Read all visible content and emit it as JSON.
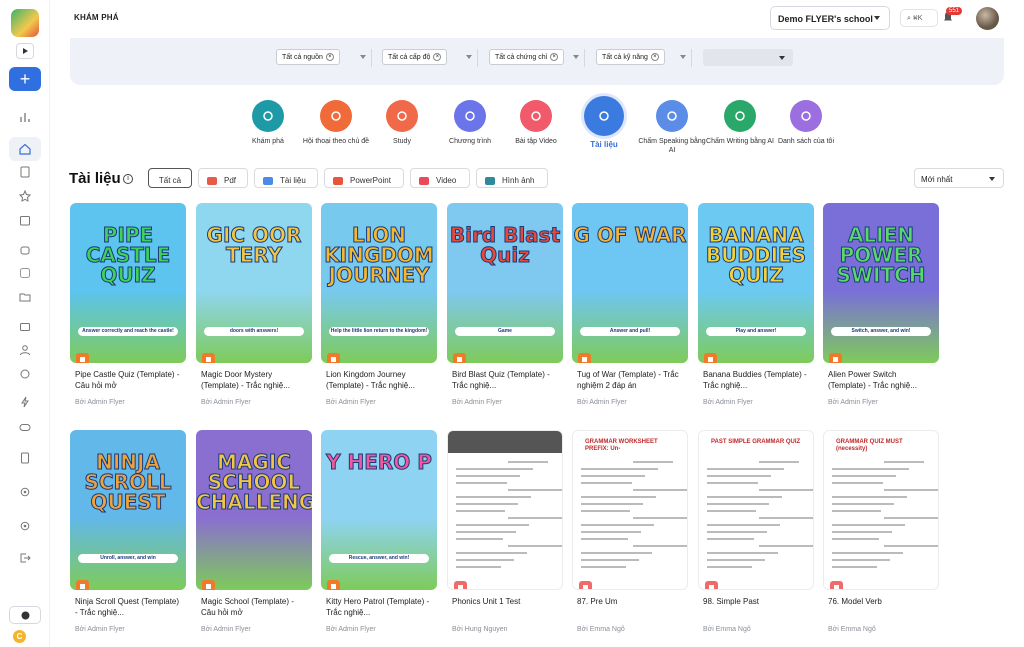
{
  "header": {
    "breadcrumb": "KHÁM PHÁ",
    "school": "Demo FLYER's school",
    "shortcut": "⌘K",
    "notification_count": "551"
  },
  "filters": [
    {
      "label": "Tất cả nguồn"
    },
    {
      "label": "Tất cả cấp độ"
    },
    {
      "label": "Tất cả chứng chỉ"
    },
    {
      "label": "Tất cả kỹ năng"
    }
  ],
  "categories": [
    {
      "label": "Khám phá",
      "color": "#1e9aa6",
      "icon": "compass-icon"
    },
    {
      "label": "Hội thoại theo chủ đề",
      "color": "#f06a3a",
      "icon": "phone-icon"
    },
    {
      "label": "Study",
      "color": "#f06a4a",
      "icon": "graduation-cap-icon"
    },
    {
      "label": "Chương trình",
      "color": "#6b74e8",
      "icon": "document-icon"
    },
    {
      "label": "Bài tập Video",
      "color": "#f05a6a",
      "icon": "video-icon"
    },
    {
      "label": "Tài liệu",
      "color": "#3b7be0",
      "icon": "word-doc-icon",
      "active": true
    },
    {
      "label": "Chấm Speaking bằng AI",
      "color": "#5b8de8",
      "icon": "microphone-icon"
    },
    {
      "label": "Chấm Writing bằng AI",
      "color": "#2aa86a",
      "icon": "pen-icon"
    },
    {
      "label": "Danh sách của tôi",
      "color": "#9b6fe0",
      "icon": "list-icon"
    }
  ],
  "section": {
    "title": "Tài liệu",
    "tabs": [
      "Tất cả",
      "Pdf",
      "Tài liệu",
      "PowerPoint",
      "Video",
      "Hình ảnh"
    ],
    "sort": "Mới nhất"
  },
  "cards": [
    {
      "title": "Pipe Castle Quiz (Template) - Câu hỏi mở",
      "author": "Bởi Admin Flyer",
      "art": "PIPE CASTLE QUIZ",
      "pill": "Answer correctly and reach the castle!",
      "bg": "#5cc4ee",
      "fg": "#3fd15a"
    },
    {
      "title": "Magic Door Mystery (Template) - Trắc nghiệ...",
      "author": "Bởi Admin Flyer",
      "art": "GIC OOR TERY",
      "pill": "doors with answers!",
      "bg": "#8fd6ef",
      "fg": "#f3c544"
    },
    {
      "title": "Lion Kingdom Journey (Template) - Trắc nghiệ...",
      "author": "Bởi Admin Flyer",
      "art": "LION KINGDOM JOURNEY",
      "pill": "Help the little lion return to the kingdom!",
      "bg": "#78c9ee",
      "fg": "#f5b730"
    },
    {
      "title": "Bird Blast Quiz (Template) - Trắc nghiệ...",
      "author": "Bởi Admin Flyer",
      "art": "Bird Blast Quiz",
      "pill": "Game",
      "bg": "#7fc8f0",
      "fg": "#e84a3a"
    },
    {
      "title": "Tug of War (Template) - Trắc nghiệm 2 đáp án",
      "author": "Bởi Admin Flyer",
      "art": "G OF WAR",
      "pill": "Answer and pull!",
      "bg": "#6ec6f2",
      "fg": "#f3b53a"
    },
    {
      "title": "Banana Buddies (Template) - Trắc nghiệ...",
      "author": "Bởi Admin Flyer",
      "art": "BANANA BUDDIES QUIZ",
      "pill": "Play and answer!",
      "bg": "#6cc9f2",
      "fg": "#f6d23a"
    },
    {
      "title": "Alien Power Switch (Template) - Trắc nghiệ...",
      "author": "Bởi Admin Flyer",
      "art": "ALIEN POWER SWITCH",
      "pill": "Switch, answer, and win!",
      "bg": "#7a6fd8",
      "fg": "#5bd86a"
    },
    {
      "title": "Ninja Scroll Quest (Template) - Trắc nghiệ...",
      "author": "Bởi Admin Flyer",
      "art": "NINJA SCROLL QUEST",
      "pill": "Unroll, answer, and win",
      "bg": "#62b8e8",
      "fg": "#f0a23a"
    },
    {
      "title": "Magic School (Template) - Câu hỏi mở",
      "author": "Bởi Admin Flyer",
      "art": "MAGIC SCHOOL CHALLENGE",
      "pill": "",
      "bg": "#8a6fd0",
      "fg": "#f3c544"
    },
    {
      "title": "Kitty Hero Patrol (Template) - Trắc nghiệ...",
      "author": "Bởi Admin Flyer",
      "art": "Y HERO P",
      "pill": "Rescue, answer, and win!",
      "bg": "#8fd3f2",
      "fg": "#f05a9a"
    },
    {
      "title": "Phonics Unit 1 Test",
      "author": "Bởi Hung Nguyen",
      "art": "",
      "pill": "",
      "doc": true
    },
    {
      "title": "87. Pre Um",
      "author": "Bởi Emma Ngô",
      "art": "GRAMMAR WORKSHEET PREFIX: Un-",
      "pill": "",
      "doc": true
    },
    {
      "title": "98. Simple Past",
      "author": "Bởi Emma Ngô",
      "art": "PAST SIMPLE GRAMMAR QUIZ",
      "pill": "",
      "doc": true
    },
    {
      "title": "76. Model Verb",
      "author": "Bởi Emma Ngô",
      "art": "GRAMMAR QUIZ MUST (necessity)",
      "pill": "",
      "doc": true
    }
  ]
}
